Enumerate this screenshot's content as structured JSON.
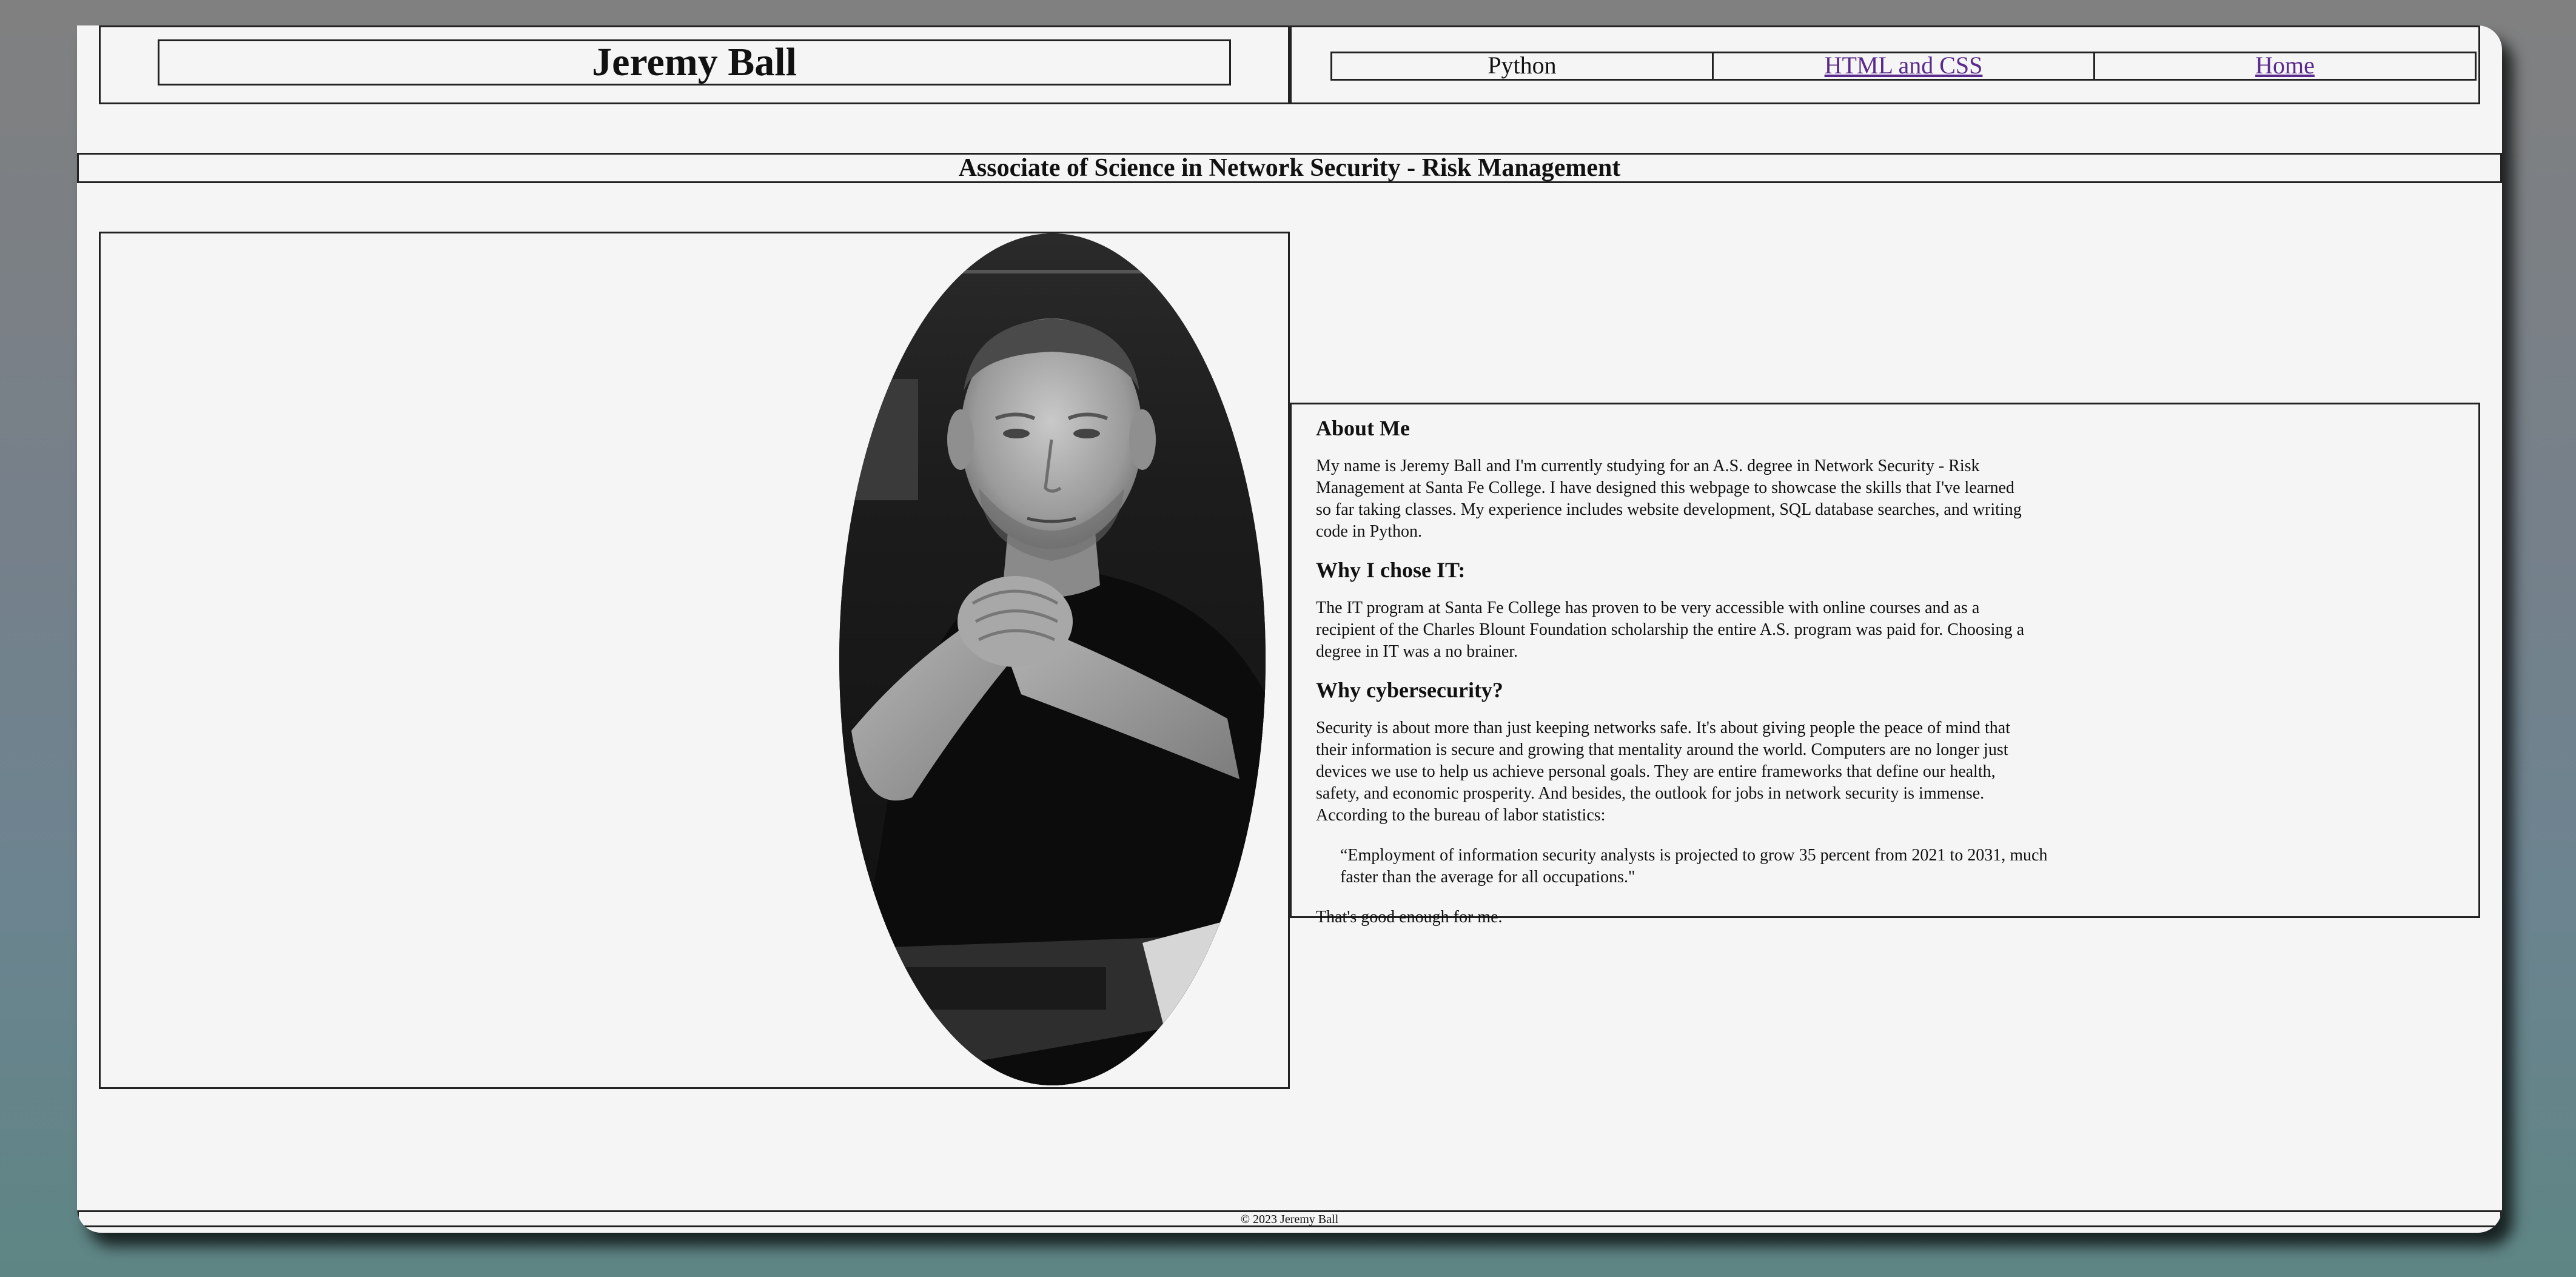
{
  "header": {
    "name": "Jeremy Ball",
    "nav": [
      {
        "label": "Python",
        "link": false
      },
      {
        "label": "HTML and CSS",
        "link": true
      },
      {
        "label": "Home",
        "link": true
      }
    ]
  },
  "subtitle": "Associate of Science in Network Security - Risk Management",
  "about": {
    "heading1": "About Me",
    "para1": "My name is Jeremy Ball and I'm currently studying for an A.S. degree in Network Security - Risk Management at Santa Fe College. I have designed this webpage to showcase the skills that I've learned so far taking classes. My experience includes website development, SQL database searches, and writing code in Python.",
    "heading2": "Why I chose IT:",
    "para2": "The IT program at Santa Fe College has proven to be very accessible with online courses and as a recipient of the Charles Blount Foundation scholarship the entire A.S. program was paid for. Choosing a degree in IT was a no brainer.",
    "heading3": "Why cybersecurity?",
    "para3": "Security is about more than just keeping networks safe. It's about giving people the peace of mind that their information is secure and growing that mentality around the world. Computers are no longer just devices we use to help us achieve personal goals. They are entire frameworks that define our health, safety, and economic prosperity. And besides, the outlook for jobs in network security is immense. According to the bureau of labor statistics:",
    "quote": "“Employment of information security analysts is projected to grow 35 percent from 2021 to 2031, much faster than the average for all occupations.\"",
    "closing": "That's good enough for me."
  },
  "footer": "© 2023 Jeremy Ball"
}
